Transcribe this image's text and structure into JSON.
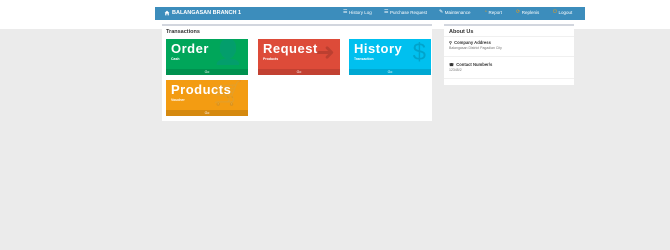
{
  "navbar": {
    "brand": "BALANGASAN BRANCH 1",
    "items": [
      {
        "label": "History Log",
        "icon": "list-icon"
      },
      {
        "label": "Purchase Request",
        "icon": "list-icon"
      },
      {
        "label": "Maintenance",
        "icon": "wrench-icon"
      },
      {
        "label": "Report",
        "icon": "chart-icon"
      },
      {
        "label": "Replenis",
        "icon": "refresh-icon"
      },
      {
        "label": "Logout",
        "icon": "power-icon"
      }
    ]
  },
  "transactions": {
    "title": "Transactions",
    "tiles": [
      {
        "title": "Order",
        "subtitle": "Cash",
        "footer": "Go",
        "icon": "user-icon",
        "color": "#00a65a"
      },
      {
        "title": "Request",
        "subtitle": "Products",
        "footer": "Go",
        "icon": "arrow-icon",
        "color": "#dd4b39"
      },
      {
        "title": "History",
        "subtitle": "Transaction",
        "footer": "Go",
        "icon": "dollar-icon",
        "color": "#00c0ef"
      },
      {
        "title": "Products",
        "subtitle": "Voucher",
        "footer": "Go",
        "icon": "cart-icon",
        "color": "#f39c12"
      }
    ]
  },
  "about": {
    "title": "About Us",
    "company_address_label": "Company Address",
    "company_address": "Balangasan District Pagadian City",
    "contact_label": "Contact Number/s",
    "contact": "12345/2"
  }
}
